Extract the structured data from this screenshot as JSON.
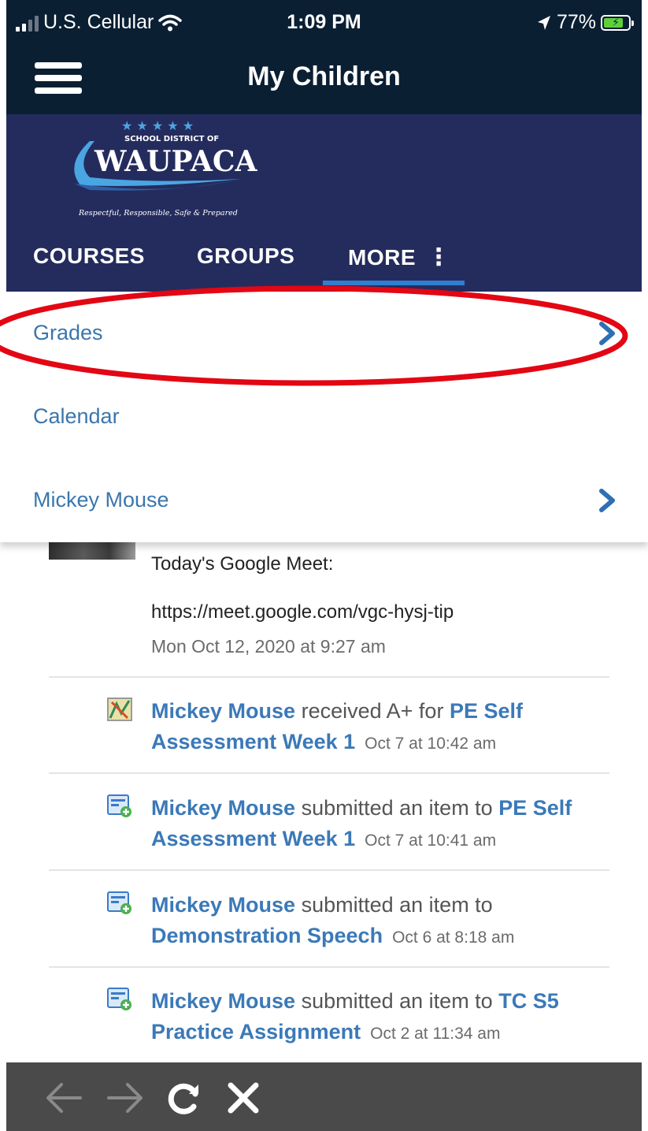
{
  "status_bar": {
    "carrier": "U.S. Cellular",
    "time": "1:09 PM",
    "battery": "77%"
  },
  "header": {
    "title": "My Children"
  },
  "logo": {
    "top_text": "SCHOOL DISTRICT OF",
    "name": "WAUPACA",
    "tagline": "Respectful, Responsible, Safe & Prepared",
    "colors": {
      "star": "#4fa3e0",
      "swoosh": "#4aa6e2"
    }
  },
  "tabs": [
    {
      "label": "COURSES"
    },
    {
      "label": "GROUPS"
    },
    {
      "label": "MORE"
    }
  ],
  "menu": [
    {
      "label": "Grades",
      "has_arrow": true
    },
    {
      "label": "Calendar",
      "has_arrow": false
    },
    {
      "label": "Mickey Mouse",
      "has_arrow": true
    }
  ],
  "post": {
    "line1": "Today's Google Meet:",
    "line2": "https://meet.google.com/vgc-hysj-tip",
    "date": "Mon Oct 12, 2020 at 9:27 am"
  },
  "activities": [
    {
      "icon": "grade-icon",
      "actor": "Mickey Mouse",
      "verb": " received A+ for ",
      "target": "PE Self Assessment Week 1",
      "time": "Oct 7 at 10:42 am"
    },
    {
      "icon": "submission-icon",
      "actor": "Mickey Mouse",
      "verb": " submitted an item to ",
      "target": "PE Self Assessment Week 1",
      "time": "Oct 7 at 10:41 am"
    },
    {
      "icon": "submission-icon",
      "actor": "Mickey Mouse",
      "verb": " submitted an item to ",
      "target": "Demonstration Speech",
      "time": "Oct 6 at 8:18 am"
    },
    {
      "icon": "submission-icon",
      "actor": "Mickey Mouse",
      "verb": " submitted an item to ",
      "target": "TC S5 Practice Assignment",
      "time": "Oct 2 at 11:34 am"
    }
  ],
  "colors": {
    "topbar": "#0b1f33",
    "brand_bar": "#242c5e",
    "link": "#3b79b8",
    "highlight_ring": "#e30613",
    "bottom_bar": "#4a4a4a"
  }
}
